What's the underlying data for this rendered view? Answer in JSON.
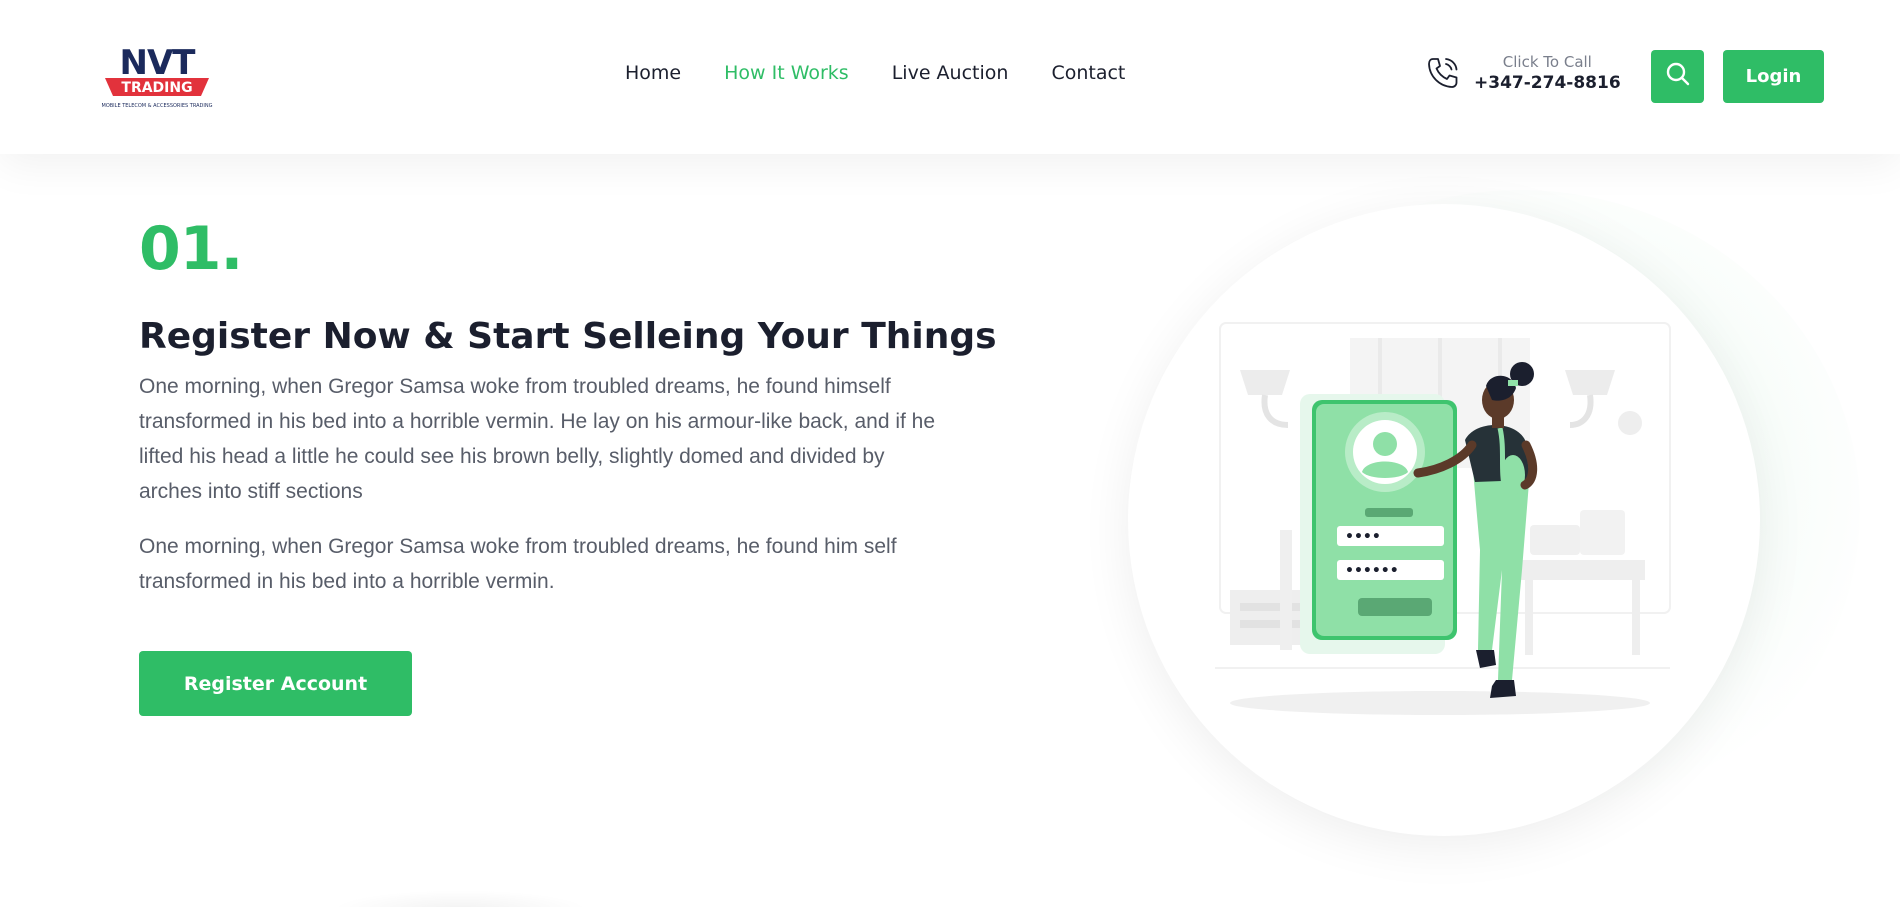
{
  "header": {
    "logo": {
      "brand_top": "NVT",
      "brand_bottom": "TRADING",
      "tagline": "MOBILE TELECOM & ACCESSORIES TRADING"
    },
    "nav": [
      {
        "label": "Home",
        "active": false
      },
      {
        "label": "How It Works",
        "active": true
      },
      {
        "label": "Live Auction",
        "active": false
      },
      {
        "label": "Contact",
        "active": false
      }
    ],
    "call": {
      "label": "Click To Call",
      "number": "+347-274-8816",
      "icon": "phone-icon"
    },
    "search_icon": "search-icon",
    "login_label": "Login"
  },
  "main": {
    "step_number": "01.",
    "headline": "Register Now & Start Selleing Your Things",
    "paragraphs": [
      "One morning, when Gregor Samsa woke from troubled dreams, he found himself transformed in his bed into a horrible vermin. He lay on his armour-like back, and if he lifted his head a little he could see his brown belly, slightly domed and divided by arches into stiff sections",
      "One morning, when Gregor Samsa woke from troubled dreams, he found him self transformed in his bed into a horrible vermin."
    ],
    "register_label": "Register Account",
    "illustration": {
      "password_short": "••••",
      "password_long": "••••••"
    }
  },
  "colors": {
    "accent": "#2fbd66",
    "heading": "#1b1f2e",
    "body_text": "#585d69",
    "brand_navy": "#1b2a5c",
    "brand_red": "#e2323c"
  }
}
